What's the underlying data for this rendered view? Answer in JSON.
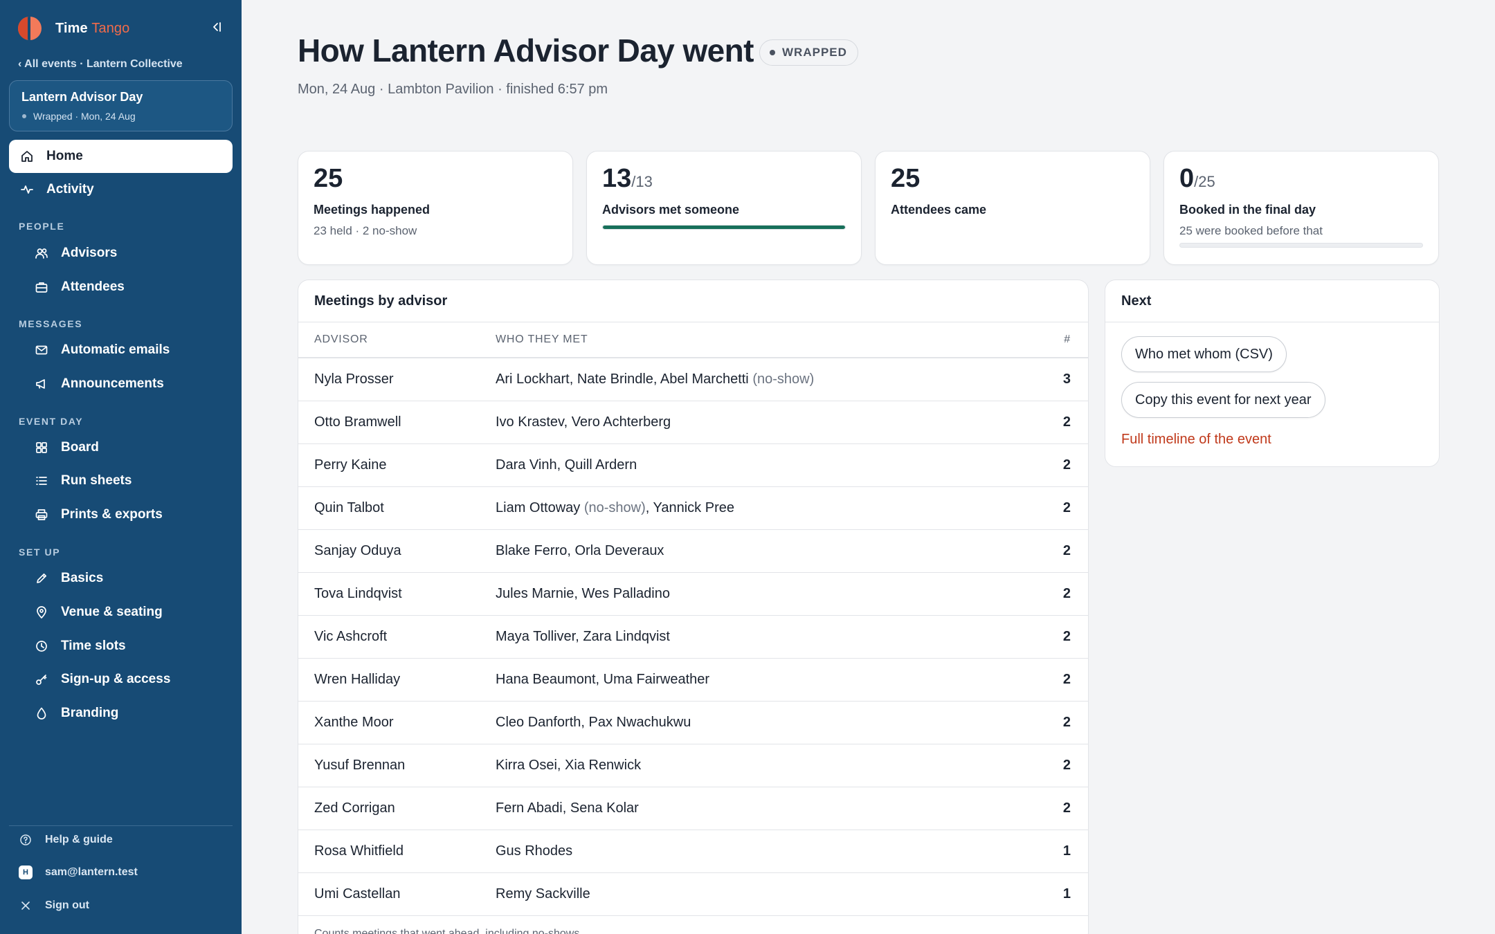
{
  "app": {
    "name_part1": "Time",
    "name_part2": "Tango"
  },
  "sidebar": {
    "breadcrumb": "‹ All events · Lantern Collective",
    "event": {
      "title": "Lantern Advisor Day",
      "meta": "Wrapped · Mon, 24 Aug"
    },
    "top_items": [
      {
        "label": "Home",
        "icon": "home-icon",
        "active": true
      },
      {
        "label": "Activity",
        "icon": "activity-icon"
      }
    ],
    "sections": [
      {
        "label": "PEOPLE",
        "items": [
          {
            "label": "Advisors",
            "icon": "users-icon"
          },
          {
            "label": "Attendees",
            "icon": "briefcase-icon"
          }
        ]
      },
      {
        "label": "MESSAGES",
        "items": [
          {
            "label": "Automatic emails",
            "icon": "mail-icon"
          },
          {
            "label": "Announcements",
            "icon": "megaphone-icon"
          }
        ]
      },
      {
        "label": "EVENT DAY",
        "items": [
          {
            "label": "Board",
            "icon": "grid-icon"
          },
          {
            "label": "Run sheets",
            "icon": "list-icon"
          },
          {
            "label": "Prints & exports",
            "icon": "printer-icon"
          }
        ]
      },
      {
        "label": "SET UP",
        "items": [
          {
            "label": "Basics",
            "icon": "pencil-icon"
          },
          {
            "label": "Venue & seating",
            "icon": "map-pin-icon"
          },
          {
            "label": "Time slots",
            "icon": "clock-icon"
          },
          {
            "label": "Sign-up & access",
            "icon": "key-icon"
          },
          {
            "label": "Branding",
            "icon": "droplet-icon"
          }
        ]
      }
    ],
    "footer": {
      "help": "Help & guide",
      "avatar_initial": "H",
      "user": "sam@lantern.test",
      "signout": "Sign out"
    }
  },
  "header": {
    "title": "How Lantern Advisor Day went",
    "badge": "WRAPPED",
    "subtitle": "Mon, 24 Aug · Lambton Pavilion · finished 6:57 pm"
  },
  "stats": [
    {
      "value": "25",
      "total": "",
      "label": "Meetings happened",
      "sub": "23 held · 2 no-show"
    },
    {
      "value": "13",
      "total": "/13",
      "label": "Advisors met someone",
      "sub": "",
      "progress": 1.0
    },
    {
      "value": "25",
      "total": "",
      "label": "Attendees came",
      "sub": ""
    },
    {
      "value": "0",
      "total": "/25",
      "label": "Booked in the final day",
      "sub": "25 were booked before that",
      "progress": 0.0
    }
  ],
  "meetings": {
    "title": "Meetings by advisor",
    "columns": {
      "advisor": "ADVISOR",
      "who": "WHO THEY MET",
      "count": "#"
    },
    "no_show_text": "(no-show)",
    "rows": [
      {
        "advisor": "Nyla Prosser",
        "met": [
          {
            "name": "Ari Lockhart"
          },
          {
            "name": "Nate Brindle"
          },
          {
            "name": "Abel Marchetti",
            "no_show": true
          }
        ],
        "count": "3"
      },
      {
        "advisor": "Otto Bramwell",
        "met": [
          {
            "name": "Ivo Krastev"
          },
          {
            "name": "Vero Achterberg"
          }
        ],
        "count": "2"
      },
      {
        "advisor": "Perry Kaine",
        "met": [
          {
            "name": "Dara Vinh"
          },
          {
            "name": "Quill Ardern"
          }
        ],
        "count": "2"
      },
      {
        "advisor": "Quin Talbot",
        "met": [
          {
            "name": "Liam Ottoway",
            "no_show": true
          },
          {
            "name": "Yannick Pree"
          }
        ],
        "count": "2"
      },
      {
        "advisor": "Sanjay Oduya",
        "met": [
          {
            "name": "Blake Ferro"
          },
          {
            "name": "Orla Deveraux"
          }
        ],
        "count": "2"
      },
      {
        "advisor": "Tova Lindqvist",
        "met": [
          {
            "name": "Jules Marnie"
          },
          {
            "name": "Wes Palladino"
          }
        ],
        "count": "2"
      },
      {
        "advisor": "Vic Ashcroft",
        "met": [
          {
            "name": "Maya Tolliver"
          },
          {
            "name": "Zara Lindqvist"
          }
        ],
        "count": "2"
      },
      {
        "advisor": "Wren Halliday",
        "met": [
          {
            "name": "Hana Beaumont"
          },
          {
            "name": "Uma Fairweather"
          }
        ],
        "count": "2"
      },
      {
        "advisor": "Xanthe Moor",
        "met": [
          {
            "name": "Cleo Danforth"
          },
          {
            "name": "Pax Nwachukwu"
          }
        ],
        "count": "2"
      },
      {
        "advisor": "Yusuf Brennan",
        "met": [
          {
            "name": "Kirra Osei"
          },
          {
            "name": "Xia Renwick"
          }
        ],
        "count": "2"
      },
      {
        "advisor": "Zed Corrigan",
        "met": [
          {
            "name": "Fern Abadi"
          },
          {
            "name": "Sena Kolar"
          }
        ],
        "count": "2"
      },
      {
        "advisor": "Rosa Whitfield",
        "met": [
          {
            "name": "Gus Rhodes"
          }
        ],
        "count": "1"
      },
      {
        "advisor": "Umi Castellan",
        "met": [
          {
            "name": "Remy Sackville"
          }
        ],
        "count": "1"
      }
    ],
    "note": "Counts meetings that went ahead, including no-shows."
  },
  "next": {
    "title": "Next",
    "csv_button": "Who met whom (CSV)",
    "copy_button": "Copy this event for next year",
    "timeline_link": "Full timeline of the event"
  },
  "colors": {
    "sidebar": "#174b75",
    "accent": "#f26b4a",
    "progress": "#17705a",
    "link": "#c0391b"
  }
}
